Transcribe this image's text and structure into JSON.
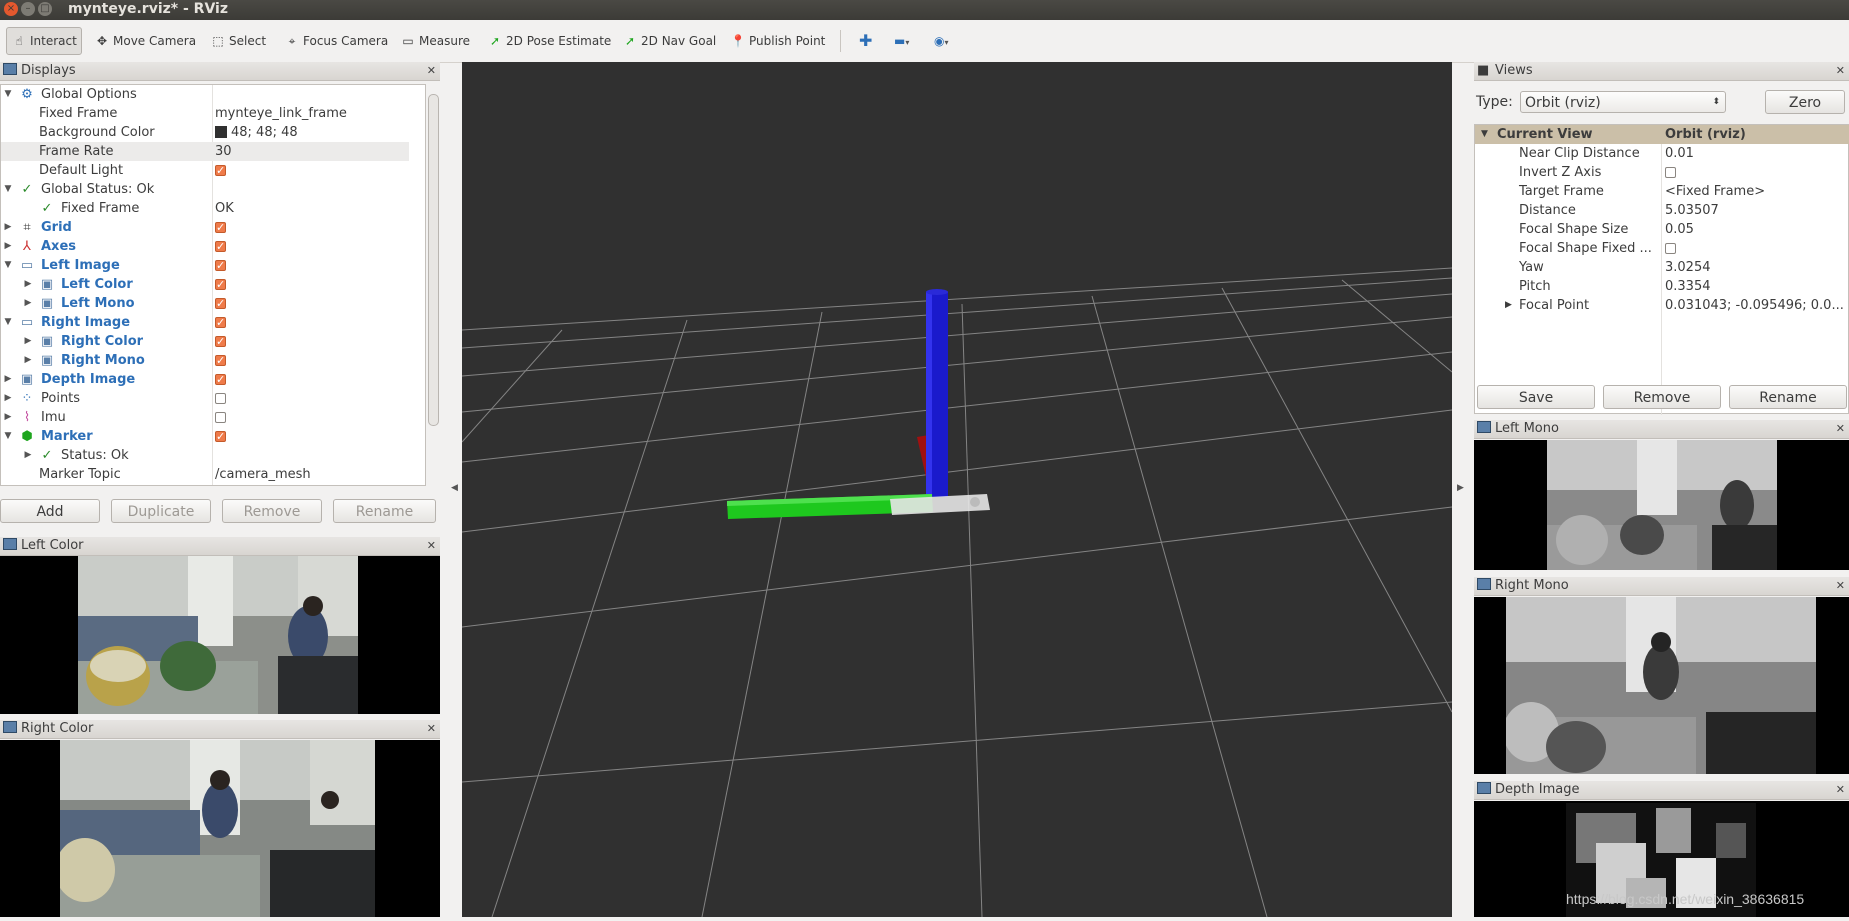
{
  "window": {
    "title": "mynteye.rviz* - RViz"
  },
  "toolbar": {
    "tools": [
      "Interact",
      "Move Camera",
      "Select",
      "Focus Camera",
      "Measure",
      "2D Pose Estimate",
      "2D Nav Goal",
      "Publish Point"
    ]
  },
  "displays_panel": {
    "title": "Displays",
    "rows": [
      {
        "label": "Global Options",
        "value": ""
      },
      {
        "label": "Fixed Frame",
        "value": "mynteye_link_frame"
      },
      {
        "label": "Background Color",
        "value": "48; 48; 48"
      },
      {
        "label": "Frame Rate",
        "value": "30"
      },
      {
        "label": "Default Light",
        "value": ""
      },
      {
        "label": "Global Status: Ok",
        "value": ""
      },
      {
        "label": "Fixed Frame",
        "value": "OK"
      },
      {
        "label": "Grid",
        "value": ""
      },
      {
        "label": "Axes",
        "value": ""
      },
      {
        "label": "Left Image",
        "value": ""
      },
      {
        "label": "Left Color",
        "value": ""
      },
      {
        "label": "Left Mono",
        "value": ""
      },
      {
        "label": "Right Image",
        "value": ""
      },
      {
        "label": "Right Color",
        "value": ""
      },
      {
        "label": "Right Mono",
        "value": ""
      },
      {
        "label": "Depth Image",
        "value": ""
      },
      {
        "label": "Points",
        "value": ""
      },
      {
        "label": "Imu",
        "value": ""
      },
      {
        "label": "Marker",
        "value": ""
      },
      {
        "label": "Status: Ok",
        "value": ""
      },
      {
        "label": "Marker Topic",
        "value": "/camera_mesh"
      }
    ],
    "buttons": {
      "add": "Add",
      "duplicate": "Duplicate",
      "remove": "Remove",
      "rename": "Rename"
    }
  },
  "left_color_panel": {
    "title": "Left Color"
  },
  "right_color_panel": {
    "title": "Right Color"
  },
  "views_panel": {
    "title": "Views",
    "type_label": "Type:",
    "type_value": "Orbit (rviz)",
    "zero_button": "Zero",
    "header_key": "Current View",
    "header_value": "Orbit (rviz)",
    "rows": [
      {
        "label": "Near Clip Distance",
        "value": "0.01"
      },
      {
        "label": "Invert Z Axis",
        "value": ""
      },
      {
        "label": "Target Frame",
        "value": "<Fixed Frame>"
      },
      {
        "label": "Distance",
        "value": "5.03507"
      },
      {
        "label": "Focal Shape Size",
        "value": "0.05"
      },
      {
        "label": "Focal Shape Fixed ...",
        "value": ""
      },
      {
        "label": "Yaw",
        "value": "3.0254"
      },
      {
        "label": "Pitch",
        "value": "0.3354"
      },
      {
        "label": "Focal Point",
        "value": "0.031043; -0.095496; 0.0..."
      }
    ],
    "buttons": {
      "save": "Save",
      "remove": "Remove",
      "rename": "Rename"
    }
  },
  "left_mono_panel": {
    "title": "Left Mono"
  },
  "right_mono_panel": {
    "title": "Right Mono"
  },
  "depth_image_panel": {
    "title": "Depth Image"
  },
  "watermark": "https://blog.csdn.net/weixin_38636815",
  "colors": {
    "viewport_bg": "#303030",
    "highlight_blue": "#2d6fb7",
    "checkbox_orange": "#ef7b4a"
  }
}
